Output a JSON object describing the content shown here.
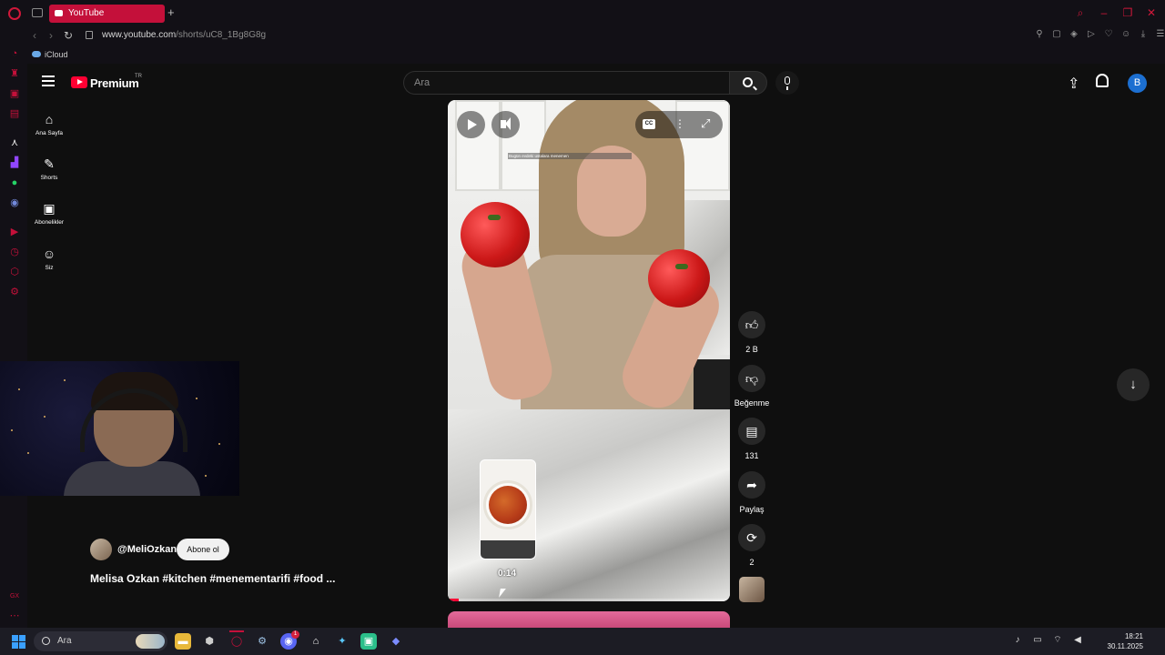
{
  "browser": {
    "tab_title": "YouTube",
    "tab_add": "+",
    "url_host": "www.youtube.com",
    "url_path": "/shorts/uC8_1Bg8G8g",
    "bookmark_label": "iCloud",
    "accent_color": "#c4103a"
  },
  "masthead": {
    "logo_text": "Premium",
    "country_code": "TR",
    "search_placeholder": "Ara",
    "avatar_letter": "B"
  },
  "guide": {
    "items": [
      {
        "label": "Ana Sayfa",
        "icon": "home-icon"
      },
      {
        "label": "Shorts",
        "icon": "shorts-icon"
      },
      {
        "label": "Abonelikler",
        "icon": "subscriptions-icon"
      },
      {
        "label": "Siz",
        "icon": "you-icon"
      }
    ]
  },
  "short": {
    "caption_overlay": "Bugün evdeki ustalara menemen",
    "hover_time": "0:14",
    "progress_fraction": 0.04,
    "channel_handle": "@MeliOzkan",
    "subscribe_label": "Abone ol",
    "title": "Melisa Ozkan #kitchen #menementarifi #food ..."
  },
  "actions": {
    "like_count": "2 B",
    "dislike_label": "Beğenme",
    "comment_count": "131",
    "share_label": "Paylaş",
    "remix_count": "2"
  },
  "taskbar": {
    "search_placeholder": "Ara",
    "time": "18:21",
    "date": "30.11.2025",
    "discord_badge": "1"
  }
}
